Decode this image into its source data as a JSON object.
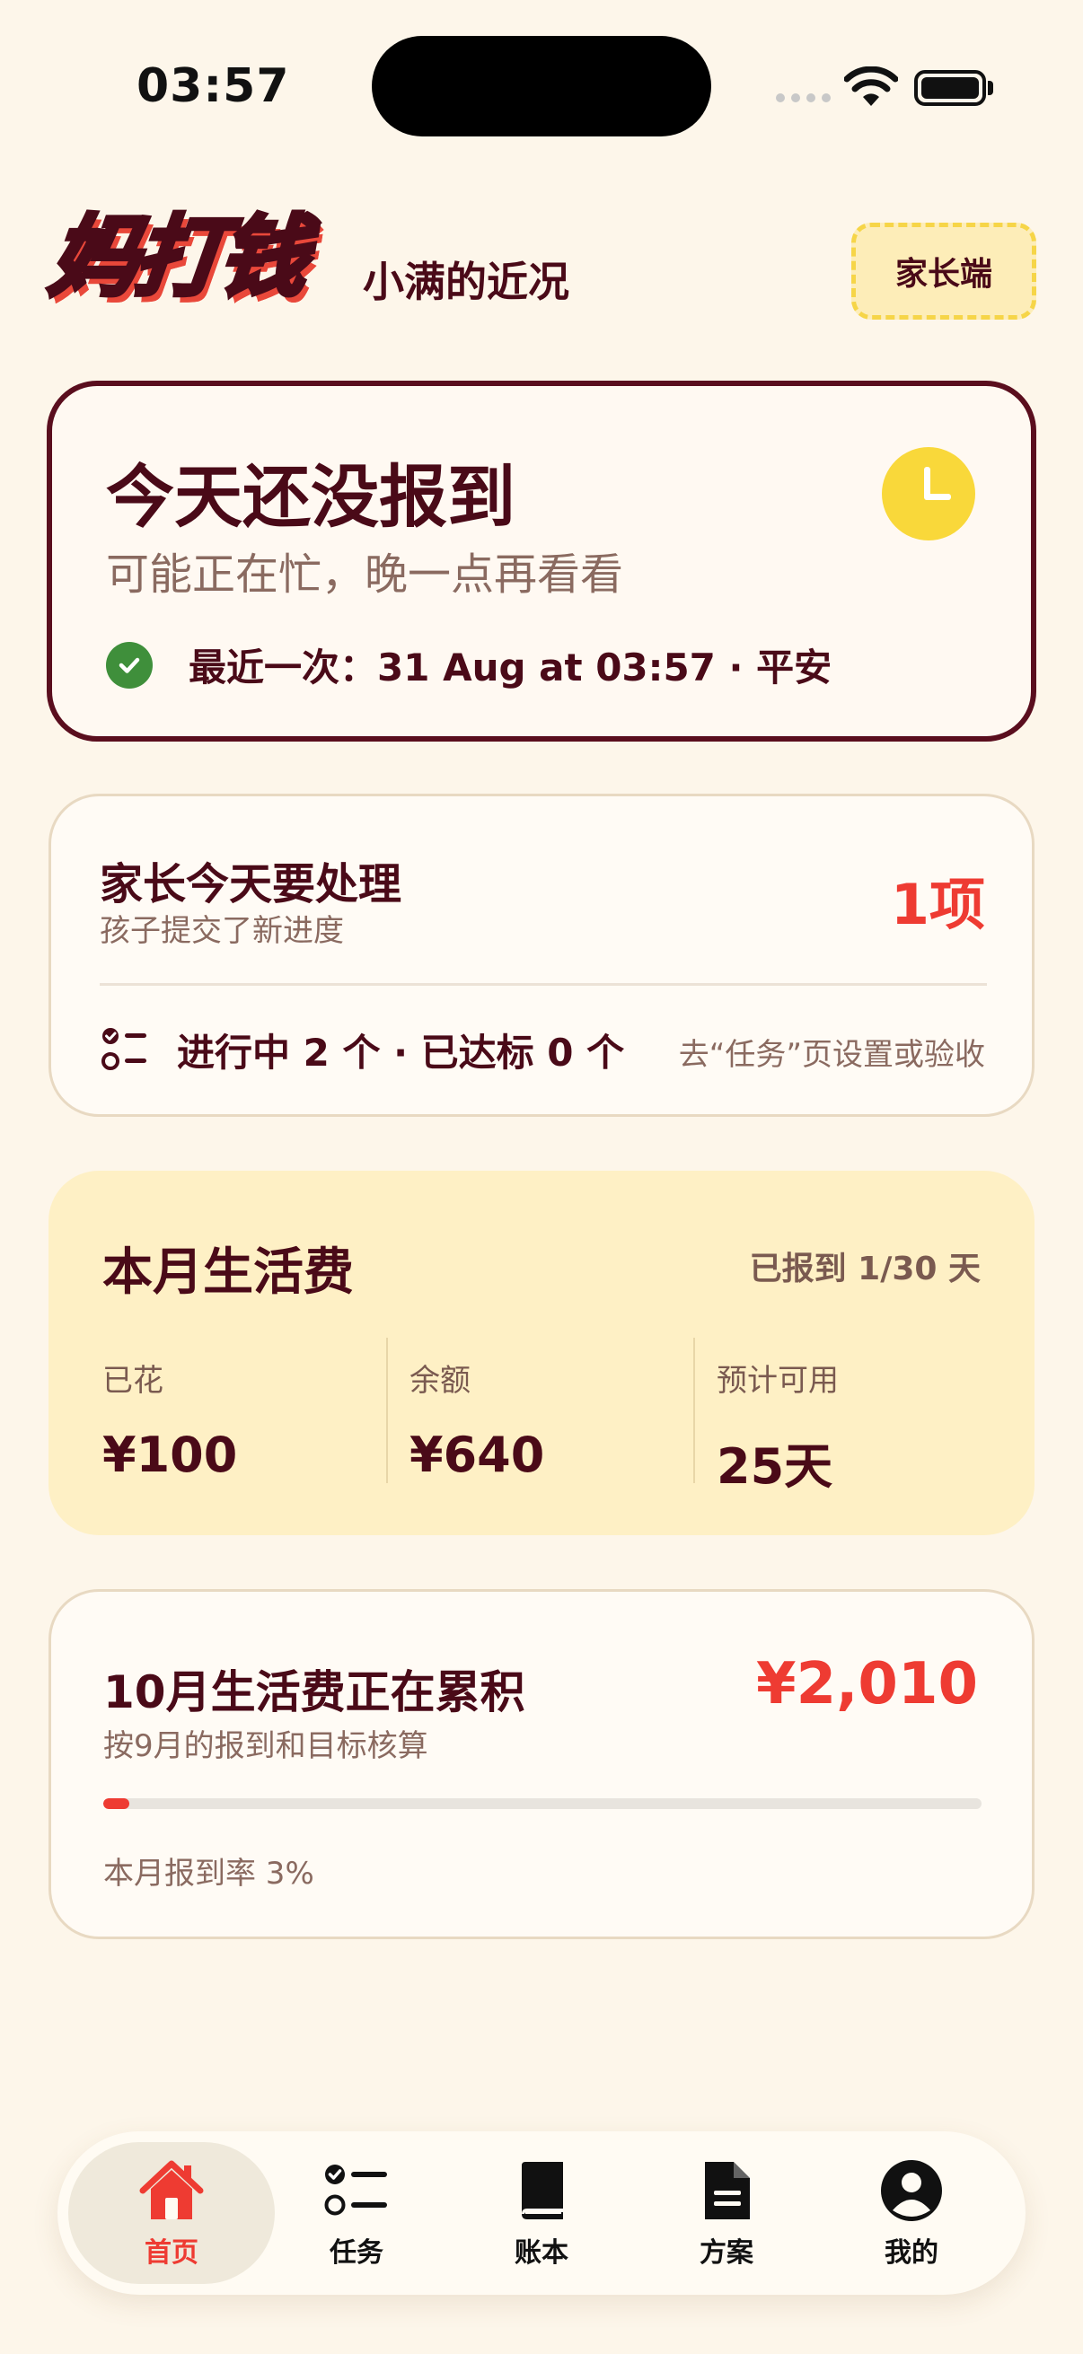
{
  "status_bar": {
    "time": "03:57"
  },
  "header": {
    "logo_char_first": "妈",
    "logo_rest": "打钱",
    "subtitle": "小满的近况",
    "parent_button": "家长端"
  },
  "checkin": {
    "title": "今天还没报到",
    "subtitle": "可能正在忙，晚一点再看看",
    "last_checkin": "最近一次：31 Aug at 03:57 · 平安",
    "icon": "clock-icon"
  },
  "todo": {
    "title": "家长今天要处理",
    "subtitle": "孩子提交了新进度",
    "count": "1项",
    "progress": "进行中 2 个 · 已达标 0 个",
    "hint": "去“任务”页设置或验收"
  },
  "budget": {
    "title": "本月生活费",
    "checkin_days": "已报到 1/30 天",
    "stats": [
      {
        "label": "已花",
        "value": "¥100"
      },
      {
        "label": "余额",
        "value": "¥640"
      },
      {
        "label": "预计可用",
        "value": "25天"
      }
    ]
  },
  "accrual": {
    "title": "10月生活费正在累积",
    "subtitle": "按9月的报到和目标核算",
    "amount": "¥2,010",
    "progress_percent": 3,
    "rate_text": "本月报到率 3%"
  },
  "tabs": [
    {
      "label": "首页",
      "icon": "home-icon",
      "active": true
    },
    {
      "label": "任务",
      "icon": "tasks-icon",
      "active": false
    },
    {
      "label": "账本",
      "icon": "book-icon",
      "active": false
    },
    {
      "label": "方案",
      "icon": "document-icon",
      "active": false
    },
    {
      "label": "我的",
      "icon": "profile-icon",
      "active": false
    }
  ],
  "colors": {
    "background": "#FDF6EA",
    "primary_text": "#4A0A18",
    "accent_red": "#EE3B32",
    "accent_yellow": "#F9D83A",
    "success_green": "#3F8F3B"
  }
}
